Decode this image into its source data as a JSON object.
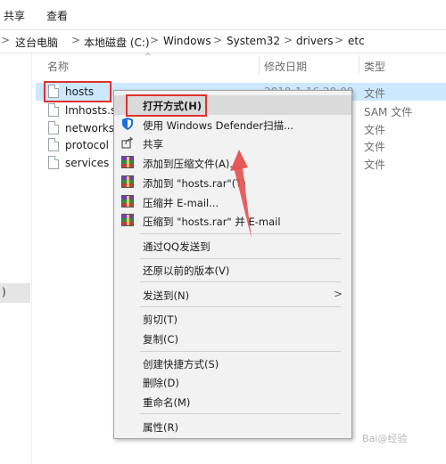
{
  "ribbon": {
    "tabs": [
      "共享",
      "查看"
    ]
  },
  "address": {
    "crumbs": [
      "这台电脑",
      "本地磁盘 (C:)",
      "Windows",
      "System32",
      "drivers",
      "etc"
    ]
  },
  "columns": {
    "name": "名称",
    "date": "修改日期",
    "type": "类型"
  },
  "files": [
    {
      "name": "hosts",
      "date": "2019-1-16 20:09",
      "type": "文件",
      "selected": true
    },
    {
      "name": "lmhosts.sam",
      "date": "",
      "type": "SAM 文件"
    },
    {
      "name": "networks",
      "date": "",
      "type": "文件"
    },
    {
      "name": "protocol",
      "date": "",
      "type": "文件"
    },
    {
      "name": "services",
      "date": "",
      "type": "文件"
    }
  ],
  "nav": {
    "selected_label": ")"
  },
  "context_menu": {
    "open_with": "打开方式(H)",
    "defender": "使用 Windows Defender扫描...",
    "share": "共享",
    "add_archive": "添加到压缩文件(A)...",
    "add_hosts_rar": "添加到 \"hosts.rar\"(T)",
    "compress_email": "压缩并 E-mail...",
    "compress_hosts_email": "压缩到 \"hosts.rar\" 并 E-mail",
    "qq_send": "通过QQ发送到",
    "restore": "还原以前的版本(V)",
    "send_to": "发送到(N)",
    "cut": "剪切(T)",
    "copy": "复制(C)",
    "shortcut": "创建快捷方式(S)",
    "delete": "删除(D)",
    "rename": "重命名(M)",
    "properties": "属性(R)"
  },
  "watermark": "Bai@经验",
  "colors": {
    "selection": "#cce8ff",
    "annotation_red": "#e03030",
    "menu_bg": "#f2f2f2"
  }
}
